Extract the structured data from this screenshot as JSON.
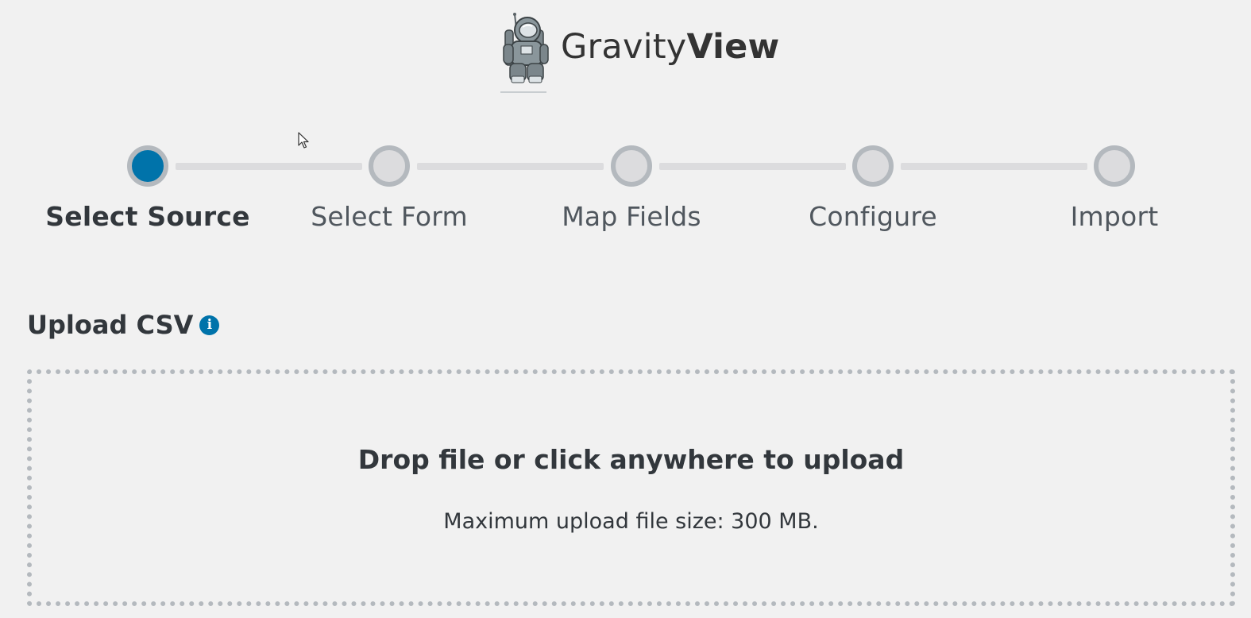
{
  "header": {
    "brand_light": "Gravity",
    "brand_bold": "View",
    "logo_icon": "astronaut-logo-icon"
  },
  "steps": [
    {
      "label": "Select Source",
      "active": true
    },
    {
      "label": "Select Form",
      "active": false
    },
    {
      "label": "Map Fields",
      "active": false
    },
    {
      "label": "Configure",
      "active": false
    },
    {
      "label": "Import",
      "active": false
    }
  ],
  "upload": {
    "title": "Upload CSV",
    "info_icon": "info-icon",
    "drop_title": "Drop file or click anywhere to upload",
    "drop_subtitle": "Maximum upload file size: 300 MB."
  },
  "colors": {
    "accent": "#0073aa",
    "step_inactive": "#dcdcde",
    "step_ring": "#b4b9be",
    "background": "#f1f1f1",
    "text": "#32373c"
  }
}
